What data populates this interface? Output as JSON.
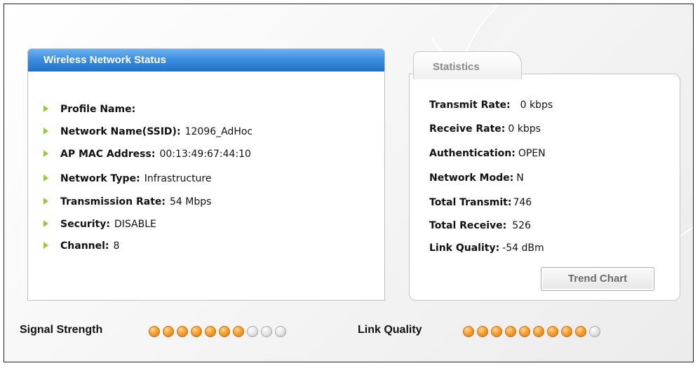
{
  "status_panel": {
    "title": "Wireless Network Status",
    "rows": [
      {
        "label": "Profile Name:",
        "value": ""
      },
      {
        "label": "Network Name(SSID):",
        "value": "12096_AdHoc"
      },
      {
        "label": "AP MAC Address:",
        "value": "00:13:49:67:44:10"
      },
      {
        "label": "Network Type:",
        "value": "Infrastructure"
      },
      {
        "label": "Transmission Rate:",
        "value": "54 Mbps"
      },
      {
        "label": "Security:",
        "value": "DISABLE"
      },
      {
        "label": "Channel:",
        "value": "8"
      }
    ]
  },
  "statistics": {
    "tab_label": "Statistics",
    "rows": [
      {
        "label": "Transmit Rate:",
        "value": "0 kbps"
      },
      {
        "label": "Receive Rate:",
        "value": "0 kbps"
      },
      {
        "label": "Authentication:",
        "value": "OPEN"
      },
      {
        "label": "Network Mode:",
        "value": "N"
      },
      {
        "label": "Total Transmit:",
        "value": "746"
      },
      {
        "label": "Total Receive:",
        "value": "526"
      },
      {
        "label": "Link Quality:",
        "value": "-54 dBm"
      }
    ],
    "trend_button_label": "Trend Chart"
  },
  "meters": {
    "signal_strength": {
      "label": "Signal Strength",
      "filled": 7,
      "total": 10
    },
    "link_quality": {
      "label": "Link Quality",
      "filled": 9,
      "total": 10
    }
  },
  "colors": {
    "header_blue": "#2f86d8",
    "bullet_green": "#97c93d",
    "dot_on_orange": "#f5a033",
    "dot_off_gray": "#d6d6d6"
  },
  "icons": {
    "bullet": "triangle-bullet-icon",
    "meter_dot": "led-dot-icon"
  }
}
